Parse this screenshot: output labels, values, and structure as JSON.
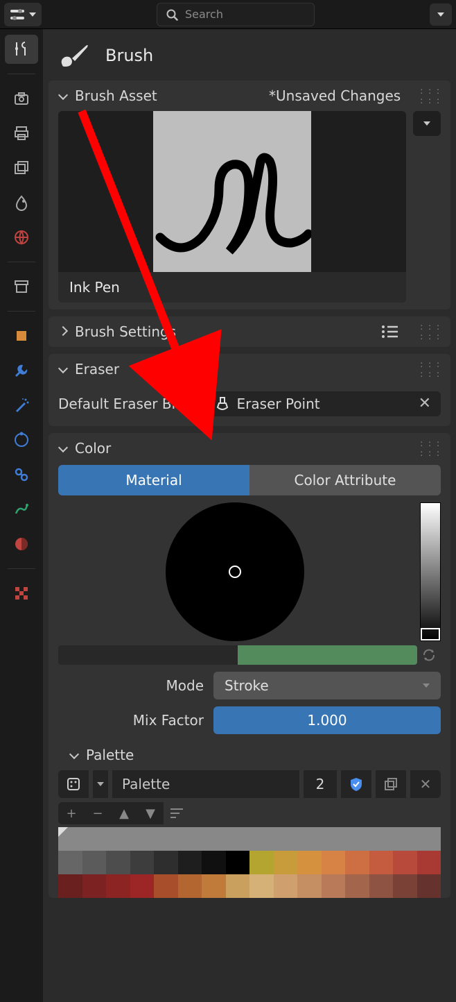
{
  "search_placeholder": "Search",
  "header_title": "Brush",
  "panels": {
    "brush_asset": {
      "title": "Brush Asset",
      "unsaved": "*Unsaved Changes",
      "preview_name": "Ink Pen"
    },
    "brush_settings": {
      "title": "Brush Settings"
    },
    "eraser": {
      "title": "Eraser",
      "field_label": "Default Eraser Bru...",
      "field_value": "Eraser Point"
    },
    "color": {
      "title": "Color",
      "tab_material": "Material",
      "tab_attribute": "Color Attribute",
      "mode_label": "Mode",
      "mode_value": "Stroke",
      "mix_label": "Mix Factor",
      "mix_value": "1.000",
      "palette_title": "Palette",
      "palette_name": "Palette",
      "palette_users": "2"
    }
  },
  "hue_swatches": [
    "#282828",
    "#538b5d"
  ],
  "palette_rows": [
    [
      "#888888",
      "#888888",
      "#888888",
      "#888888",
      "#888888",
      "#888888",
      "#888888",
      "#888888",
      "#888888",
      "#888888",
      "#888888",
      "#888888",
      "#888888",
      "#888888",
      "#888888",
      "#888888"
    ],
    [
      "#666666",
      "#5b5b5b",
      "#4d4d4d",
      "#3d3d3d",
      "#2e2e2e",
      "#1e1e1e",
      "#101010",
      "#000000",
      "#b3a52f",
      "#c99c3b",
      "#d6913f",
      "#d78345",
      "#ce6e43",
      "#c55c40",
      "#b84a3b",
      "#a83a33"
    ],
    [
      "#6b2020",
      "#7c2222",
      "#8c2424",
      "#9c2626",
      "#a84e2a",
      "#b46631",
      "#c07b3a",
      "#caa05f",
      "#d6b177",
      "#cfa06e",
      "#c68e63",
      "#b87a58",
      "#a3664d",
      "#8e5342",
      "#7a4237",
      "#65322d"
    ]
  ]
}
